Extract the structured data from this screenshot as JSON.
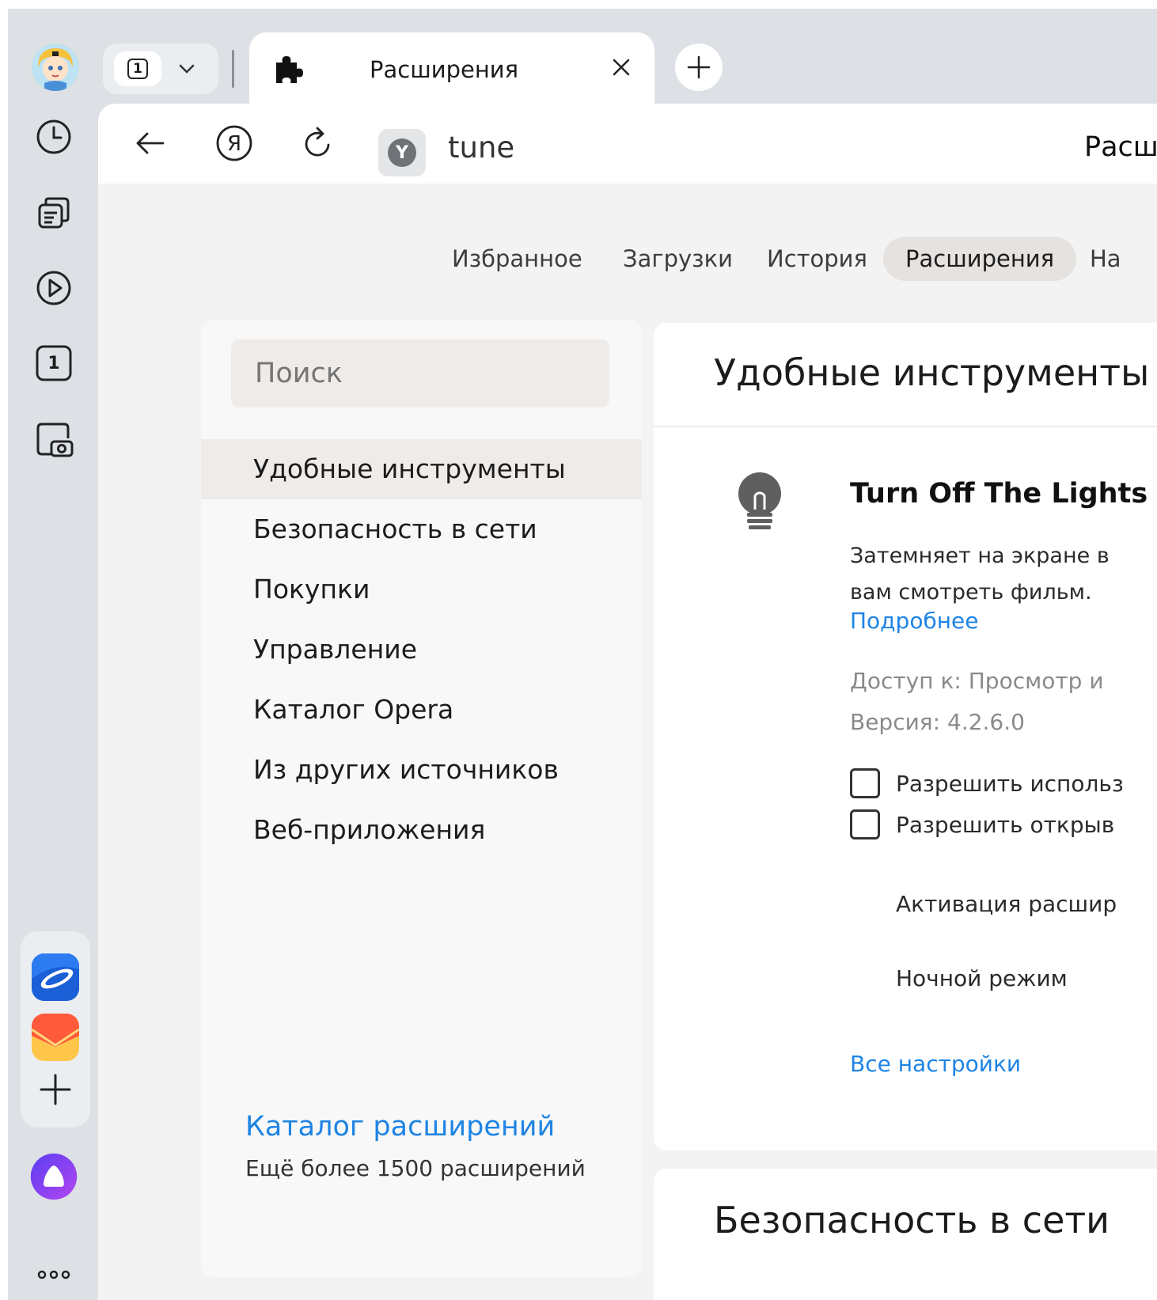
{
  "tabs": {
    "count": "1",
    "active_tab_title": "Расширения"
  },
  "addressbar": {
    "url": "tune",
    "page_title": "Расши"
  },
  "topnav": {
    "items": [
      "Избранное",
      "Загрузки",
      "История",
      "Расширения",
      "На"
    ],
    "active": "Расширения"
  },
  "sidebar_rail": {
    "icons": [
      "history-icon",
      "tabs-collections-icon",
      "video-play-icon",
      "tab-counter-icon",
      "screenshot-icon"
    ],
    "apps": [
      "browser-app-icon",
      "mail-app-icon",
      "add-app-icon"
    ],
    "assistant": "alice-assistant-icon",
    "more": "more-icon",
    "tab_counter_value": "1"
  },
  "categories": {
    "search_placeholder": "Поиск",
    "items": [
      "Удобные инструменты",
      "Безопасность в сети",
      "Покупки",
      "Управление",
      "Каталог Opera",
      "Из других источников",
      "Веб-приложения"
    ],
    "active_index": 0,
    "catalog_link": "Каталог расширений",
    "catalog_sub": "Ещё более 1500 расширений"
  },
  "main": {
    "section_title": "Удобные инструменты",
    "extension": {
      "name": "Turn Off The Lights",
      "description_line1": "Затемняет на экране в",
      "description_line2": "вам смотреть фильм.",
      "more_link": "Подробнее",
      "access": "Доступ к: Просмотр и",
      "version": "Версия: 4.2.6.0",
      "checkbox1": "Разрешить использ",
      "checkbox2": "Разрешить открыв",
      "setting1": "Активация расшир",
      "setting2": "Ночной режим",
      "all_settings": "Все настройки"
    },
    "second_section_title": "Безопасность в сети"
  },
  "colors": {
    "accent_link": "#1e84e5",
    "frame_bg": "#dde1e6",
    "active_pill": "#e6e2e0"
  }
}
